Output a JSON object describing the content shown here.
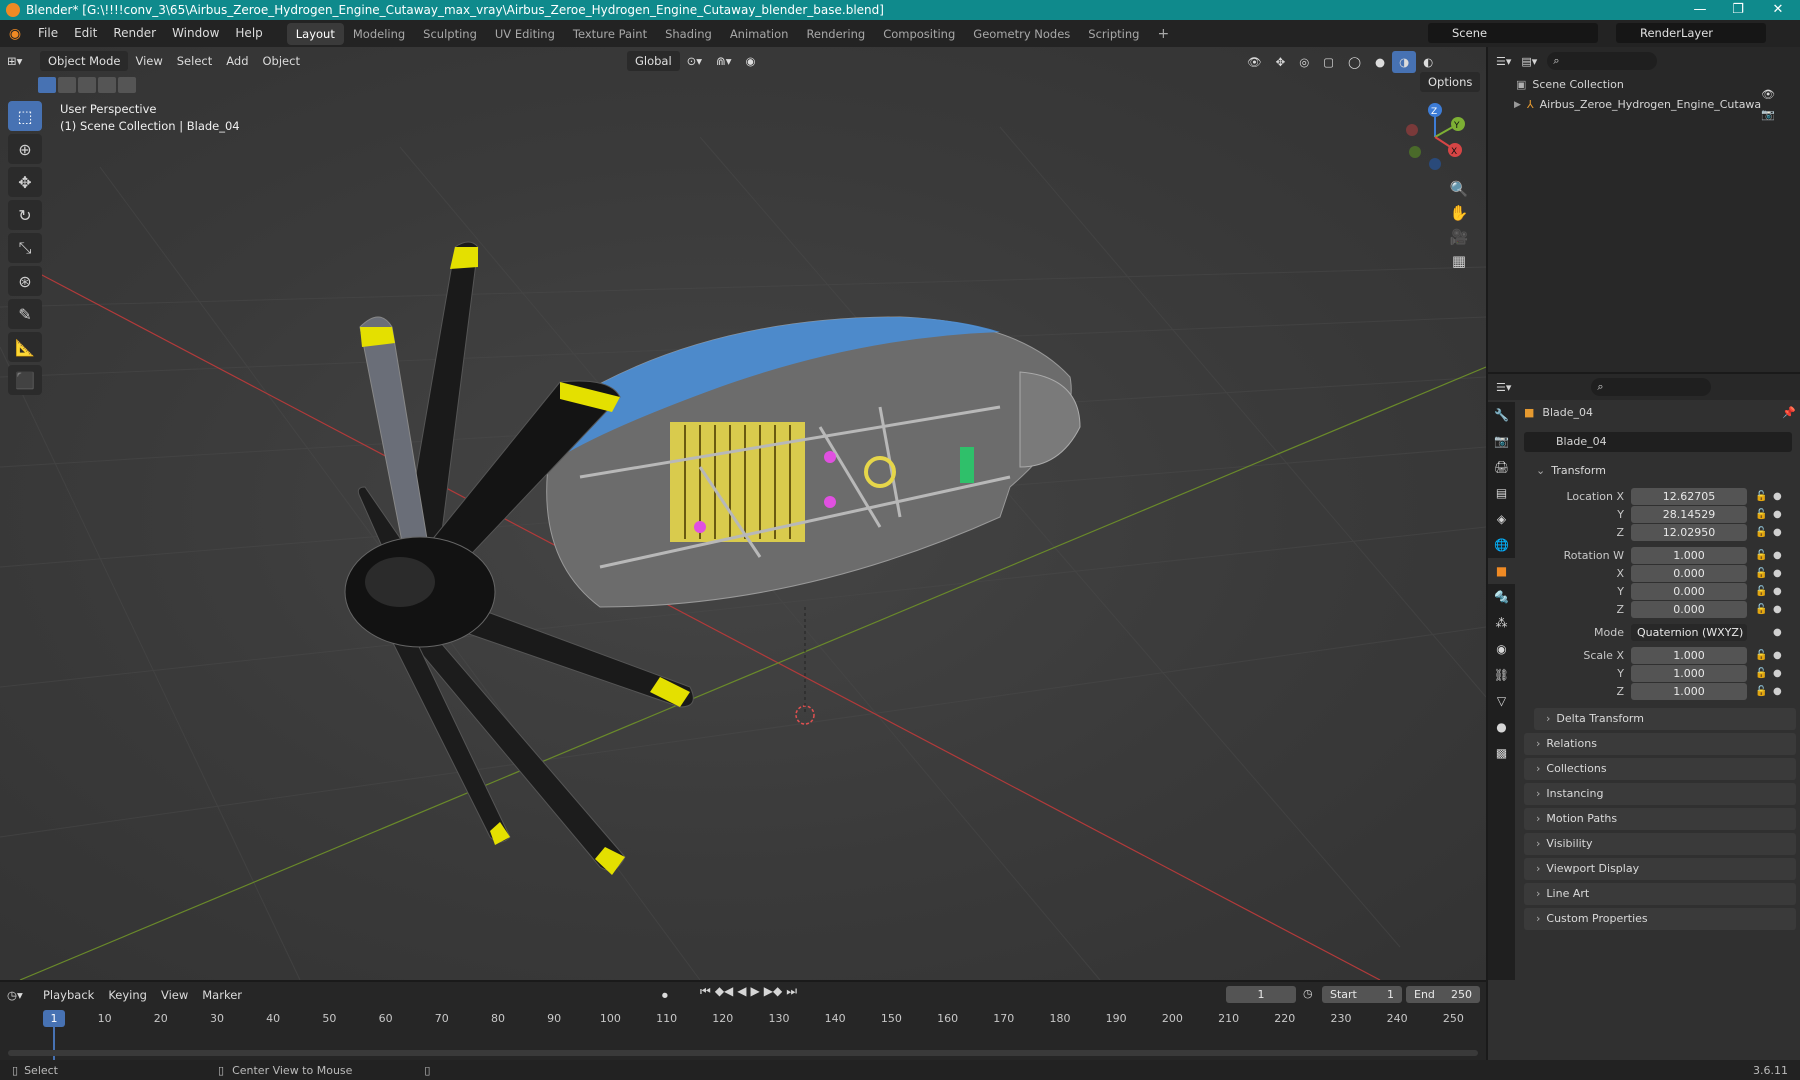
{
  "window": {
    "title": "Blender* [G:\\!!!!conv_3\\65\\Airbus_Zeroe_Hydrogen_Engine_Cutaway_max_vray\\Airbus_Zeroe_Hydrogen_Engine_Cutaway_blender_base.blend]"
  },
  "menus": [
    "File",
    "Edit",
    "Render",
    "Window",
    "Help"
  ],
  "workspaces": [
    "Layout",
    "Modeling",
    "Sculpting",
    "UV Editing",
    "Texture Paint",
    "Shading",
    "Animation",
    "Rendering",
    "Compositing",
    "Geometry Nodes",
    "Scripting"
  ],
  "active_workspace": "Layout",
  "scene": "Scene",
  "render_layer": "RenderLayer",
  "viewport": {
    "mode": "Object Mode",
    "menus": [
      "View",
      "Select",
      "Add",
      "Object"
    ],
    "orientation": "Global",
    "options_label": "Options",
    "info_line1": "User Perspective",
    "info_line2": "(1) Scene Collection | Blade_04",
    "gizmo_axes": {
      "z": "Z",
      "y": "Y",
      "x": "X"
    }
  },
  "outliner": {
    "root": "Scene Collection",
    "items": [
      "Airbus_Zeroe_Hydrogen_Engine_Cutawa"
    ]
  },
  "properties": {
    "object_name": "Blade_04",
    "object_data": "Blade_04",
    "transform_label": "Transform",
    "location": {
      "label": "Location X",
      "x": "12.62705",
      "y": "28.14529",
      "z": "12.02950"
    },
    "rotation": {
      "label": "Rotation W",
      "w": "1.000",
      "x": "0.000",
      "y": "0.000",
      "z": "0.000"
    },
    "mode": {
      "label": "Mode",
      "value": "Quaternion (WXYZ)"
    },
    "scale": {
      "label": "Scale X",
      "x": "1.000",
      "y": "1.000",
      "z": "1.000"
    },
    "axis_y": "Y",
    "axis_z": "Z",
    "axis_x": "X",
    "delta": "Delta Transform",
    "panels": [
      "Relations",
      "Collections",
      "Instancing",
      "Motion Paths",
      "Visibility",
      "Viewport Display",
      "Line Art",
      "Custom Properties"
    ]
  },
  "timeline": {
    "menus": [
      "Playback",
      "Keying",
      "View",
      "Marker"
    ],
    "current_frame": "1",
    "start_label": "Start",
    "start": "1",
    "end_label": "End",
    "end": "250",
    "ticks": [
      "1",
      "10",
      "20",
      "30",
      "40",
      "50",
      "60",
      "70",
      "80",
      "90",
      "100",
      "110",
      "120",
      "130",
      "140",
      "150",
      "160",
      "170",
      "180",
      "190",
      "200",
      "210",
      "220",
      "230",
      "240",
      "250"
    ]
  },
  "status": {
    "select": "Select",
    "center": "Center View to Mouse",
    "version": "3.6.11"
  }
}
